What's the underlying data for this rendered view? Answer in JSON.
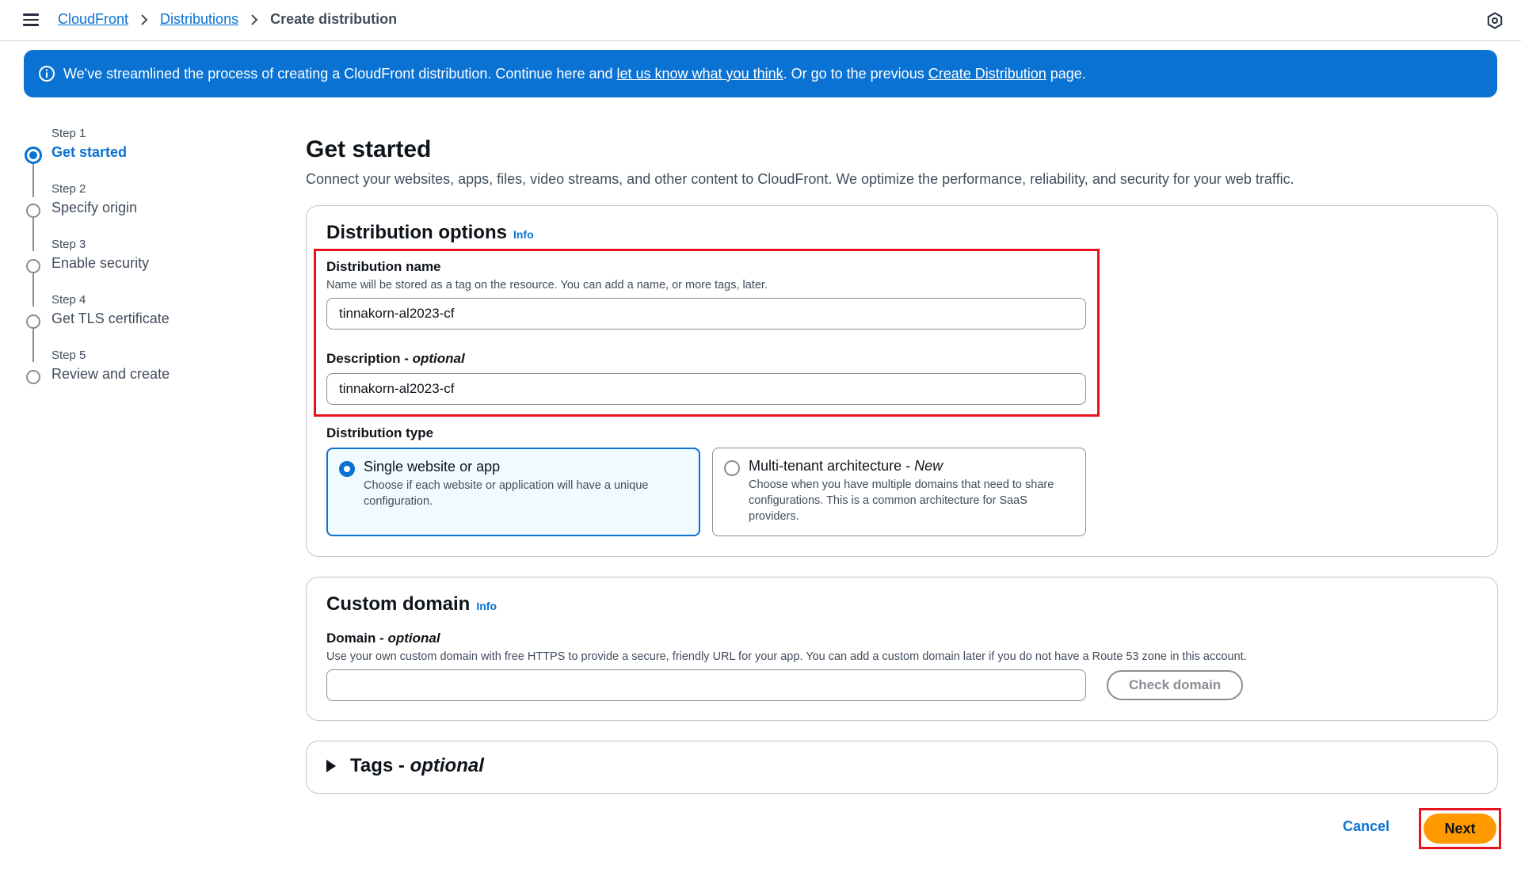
{
  "breadcrumb": {
    "items": [
      "CloudFront",
      "Distributions"
    ],
    "current": "Create distribution"
  },
  "flash": {
    "text_before": "We've streamlined the process of creating a CloudFront distribution. Continue here and ",
    "link1": "let us know what you think",
    "text_middle": ". Or go to the previous ",
    "link2": "Create Distribution",
    "text_after": " page."
  },
  "steps": [
    {
      "num": "Step 1",
      "title": "Get started",
      "active": true
    },
    {
      "num": "Step 2",
      "title": "Specify origin"
    },
    {
      "num": "Step 3",
      "title": "Enable security"
    },
    {
      "num": "Step 4",
      "title": "Get TLS certificate"
    },
    {
      "num": "Step 5",
      "title": "Review and create"
    }
  ],
  "page": {
    "title": "Get started",
    "description": "Connect your websites, apps, files, video streams, and other content to CloudFront. We optimize the performance, reliability, and security for your web traffic."
  },
  "distribution_options": {
    "title": "Distribution options",
    "info": "Info",
    "name_label": "Distribution name",
    "name_hint": "Name will be stored as a tag on the resource. You can add a name, or more tags, later.",
    "name_value": "tinnakorn-al2023-cf",
    "desc_label": "Description - ",
    "desc_label_optional": "optional",
    "desc_value": "tinnakorn-al2023-cf",
    "type_label": "Distribution type",
    "tiles": [
      {
        "title": "Single website or app",
        "title_suffix": "",
        "description": "Choose if each website or application will have a unique configuration.",
        "selected": true
      },
      {
        "title": "Multi-tenant architecture - ",
        "title_suffix": "New",
        "description": "Choose when you have multiple domains that need to share configurations. This is a common architecture for SaaS providers.",
        "selected": false
      }
    ]
  },
  "custom_domain": {
    "title": "Custom domain",
    "info": "Info",
    "label": "Domain - ",
    "label_optional": "optional",
    "hint": "Use your own custom domain with free HTTPS to provide a secure, friendly URL for your app. You can add a custom domain later if you do not have a Route 53 zone in this account.",
    "value": "",
    "check_button": "Check domain"
  },
  "tags": {
    "title": "Tags - ",
    "title_optional": "optional"
  },
  "footer": {
    "cancel": "Cancel",
    "next": "Next"
  },
  "colors": {
    "primary": "#0972d3",
    "action": "#ff9900",
    "highlight": "#e8121e"
  }
}
